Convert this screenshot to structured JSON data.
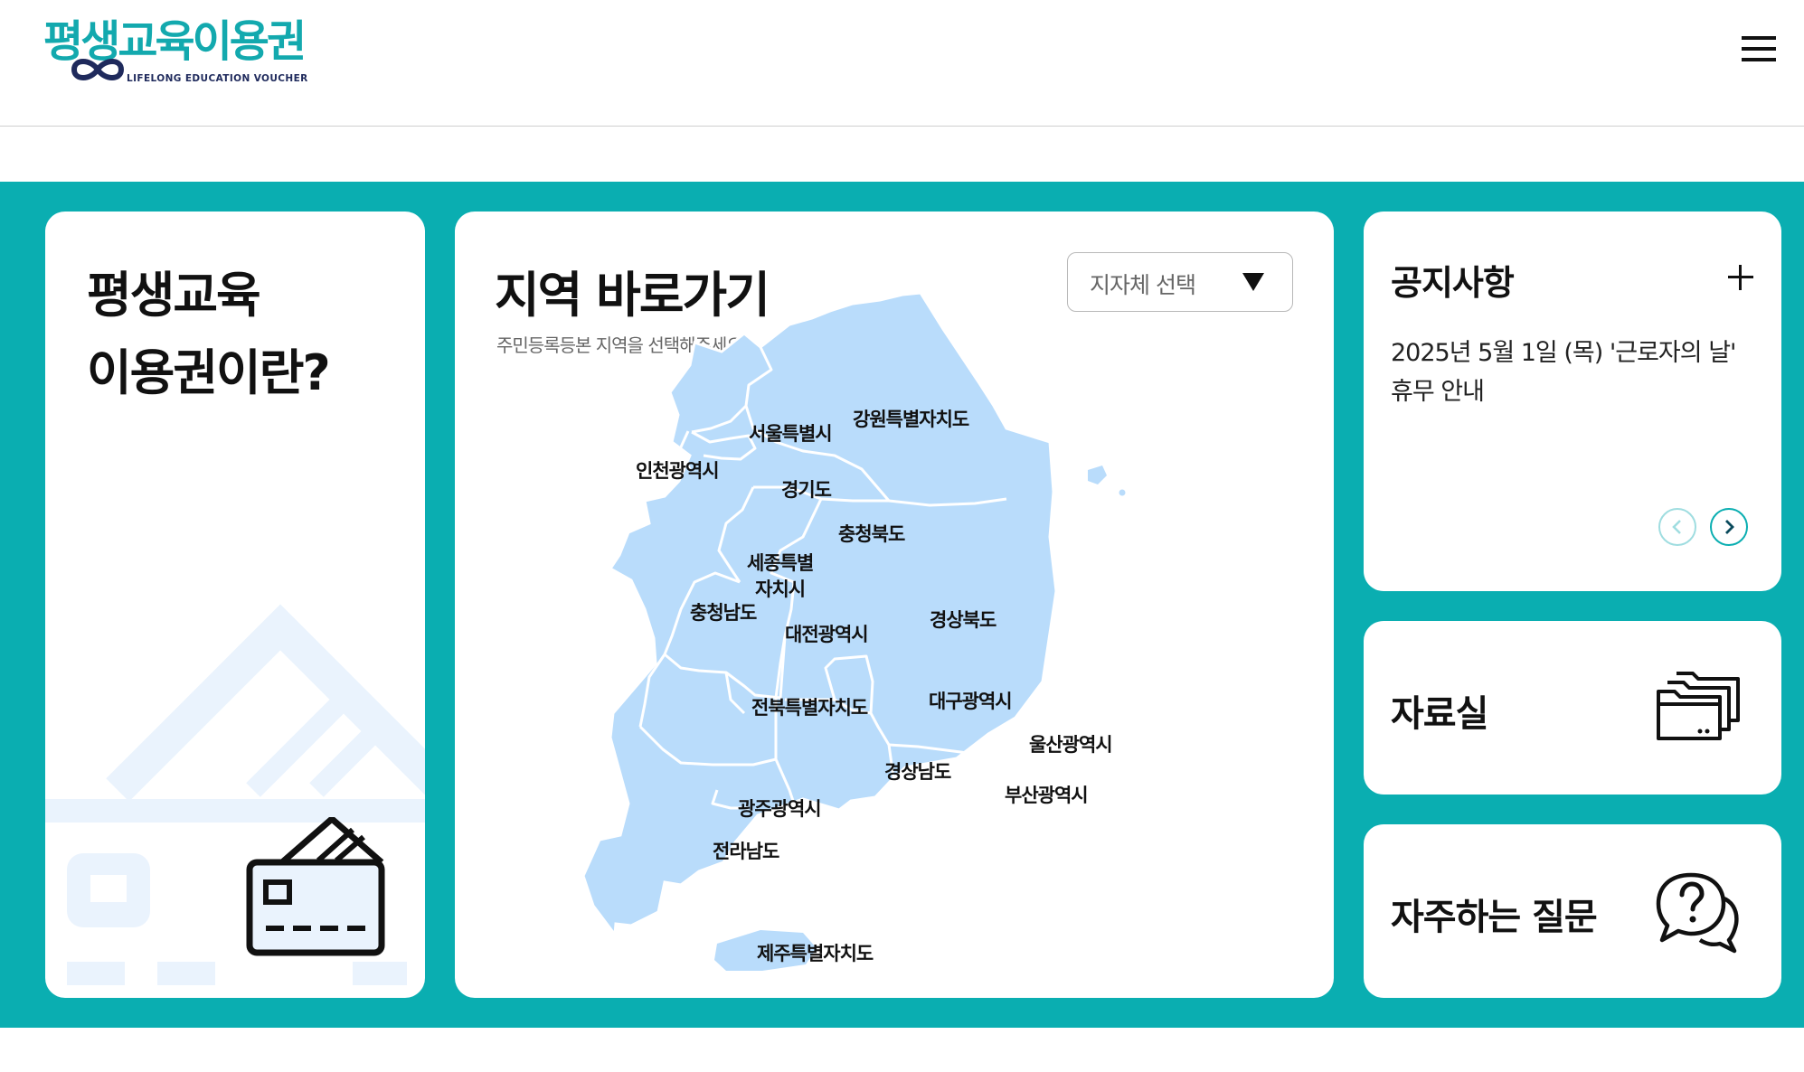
{
  "header": {
    "logo_text": "평생교육이용권",
    "logo_subtext": "LIFELONG EDUCATION VOUCHER",
    "menu_icon": "hamburger-menu-icon"
  },
  "intro_card": {
    "title": "평생교육\n이용권이란?",
    "icon": "voucher-card-icon"
  },
  "map_card": {
    "title": "지역 바로가기",
    "subtitle": "주민등록등본 지역을 선택해주세요.",
    "select": {
      "value": "지자체 선택"
    },
    "regions": {
      "seoul": "서울특별시",
      "incheon": "인천광역시",
      "gangwon": "강원특별자치도",
      "gyeonggi": "경기도",
      "chungbuk": "충청북도",
      "sejong_1": "세종특별",
      "sejong_2": "자치시",
      "chungnam": "충청남도",
      "daejeon": "대전광역시",
      "gyeongbuk": "경상북도",
      "jeonbuk": "전북특별자치도",
      "daegu": "대구광역시",
      "ulsan": "울산광역시",
      "gyeongnam": "경상남도",
      "busan": "부산광역시",
      "gwangju": "광주광역시",
      "jeonnam": "전라남도",
      "jeju": "제주특별자치도"
    }
  },
  "notice_card": {
    "title": "공지사항",
    "item": "2025년 5월 1일 (목) '근로자의 날' 휴무 안내"
  },
  "archive_card": {
    "title": "자료실",
    "icon": "folder-stack-icon"
  },
  "faq_card": {
    "title": "자주하는 질문",
    "icon": "question-bubble-icon"
  },
  "colors": {
    "brand_teal": "#0aaeb1",
    "map_fill": "#b9dcfb",
    "logo_navy": "#1f2a5c"
  }
}
